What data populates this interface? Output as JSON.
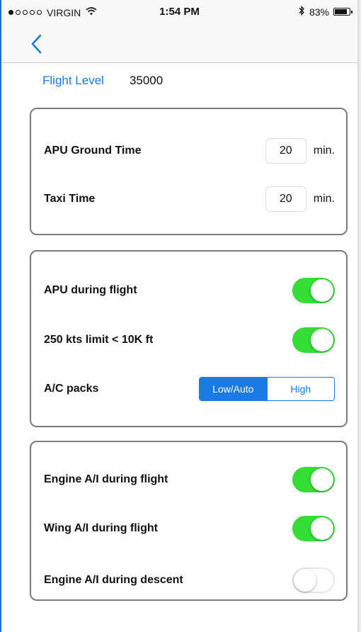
{
  "status_bar": {
    "carrier": "VIRGIN",
    "time": "1:54 PM",
    "battery": "83%",
    "battery_level": 0.83,
    "signal_dots_filled": 1,
    "signal_dots_total": 5
  },
  "nav": {
    "back_icon": "chevron-left-icon"
  },
  "flight_level": {
    "label": "Flight Level",
    "value": "35000"
  },
  "times_card": {
    "apu_ground_time": {
      "label": "APU Ground Time",
      "value": "20",
      "unit": "min."
    },
    "taxi_time": {
      "label": "Taxi Time",
      "value": "20",
      "unit": "min."
    }
  },
  "flight_card": {
    "apu_during_flight": {
      "label": "APU during flight",
      "on": true
    },
    "speed_limit": {
      "label": "250 kts limit < 10K ft",
      "on": true
    },
    "ac_packs": {
      "label": "A/C packs",
      "options": [
        "Low/Auto",
        "High"
      ],
      "selected": "Low/Auto"
    }
  },
  "anti_ice_card": {
    "engine_ai_flight": {
      "label": "Engine A/I during flight",
      "on": true
    },
    "wing_ai_flight": {
      "label": "Wing A/I during flight",
      "on": true
    },
    "engine_ai_descent": {
      "label": "Engine A/I during descent",
      "on": false
    }
  },
  "colors": {
    "accent": "#1a7be2",
    "toggle_on": "#33dd33",
    "card_border": "#7a7a7a"
  }
}
